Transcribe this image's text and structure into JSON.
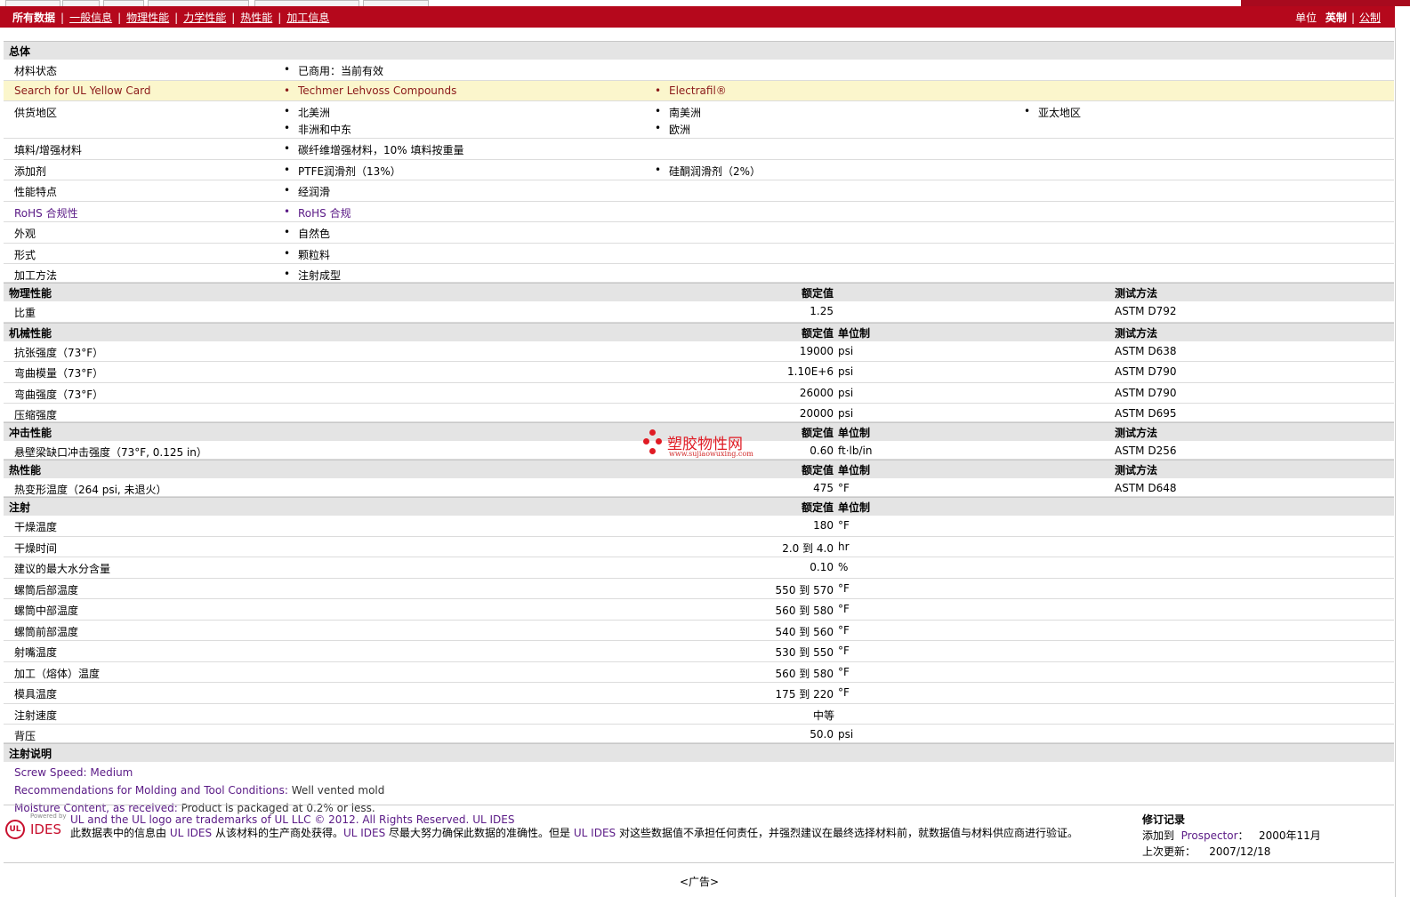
{
  "nav": {
    "items": [
      "所有数据",
      "一般信息",
      "物理性能",
      "力学性能",
      "热性能",
      "加工信息"
    ],
    "units_label": "单位",
    "unit_active": "英制",
    "unit_other": "公制"
  },
  "general": {
    "title": "总体",
    "material_status": {
      "label": "材料状态",
      "values": [
        "已商用：当前有效"
      ]
    },
    "yellow_card": {
      "label": "Search for UL Yellow Card",
      "values": [
        "Techmer Lehvoss Compounds",
        "Electrafil®"
      ]
    },
    "supply_region": {
      "label": "供货地区",
      "values": [
        "北美洲",
        "南美洲",
        "亚太地区",
        "非洲和中东",
        "欧洲"
      ]
    },
    "filler": {
      "label": "填料/增强材料",
      "values": [
        "碳纤维增强材料，10% 填料按重量"
      ]
    },
    "additive": {
      "label": "添加剂",
      "values": [
        "PTFE润滑剂（13%）",
        "硅酮润滑剂（2%）"
      ]
    },
    "features": {
      "label": "性能特点",
      "values": [
        "经润滑"
      ]
    },
    "rohs": {
      "label": "RoHS 合规性",
      "values": [
        "RoHS 合规"
      ]
    },
    "appearance": {
      "label": "外观",
      "values": [
        "自然色"
      ]
    },
    "form": {
      "label": "形式",
      "values": [
        "颗粒料"
      ]
    },
    "processing": {
      "label": "加工方法",
      "values": [
        "注射成型"
      ]
    }
  },
  "physical": {
    "title": "物理性能",
    "col_value": "额定值",
    "col_method": "测试方法",
    "rows": [
      {
        "label": "比重",
        "value": "1.25",
        "method": "ASTM D792"
      }
    ]
  },
  "mechanical": {
    "title": "机械性能",
    "col_value": "额定值",
    "col_unit": "单位制",
    "col_method": "测试方法",
    "rows": [
      {
        "label": "抗张强度（73°F）",
        "value": "19000",
        "unit": "psi",
        "method": "ASTM D638"
      },
      {
        "label": "弯曲模量（73°F）",
        "value": "1.10E+6",
        "unit": "psi",
        "method": "ASTM D790"
      },
      {
        "label": "弯曲强度（73°F）",
        "value": "26000",
        "unit": "psi",
        "method": "ASTM D790"
      },
      {
        "label": "压缩强度",
        "value": "20000",
        "unit": "psi",
        "method": "ASTM D695"
      }
    ]
  },
  "impact": {
    "title": "冲击性能",
    "col_value": "额定值",
    "col_unit": "单位制",
    "col_method": "测试方法",
    "rows": [
      {
        "label": "悬壁梁缺口冲击强度（73°F, 0.125 in）",
        "value": "0.60",
        "unit": "ft·lb/in",
        "method": "ASTM D256"
      }
    ]
  },
  "thermal": {
    "title": "热性能",
    "col_value": "额定值",
    "col_unit": "单位制",
    "col_method": "测试方法",
    "rows": [
      {
        "label": "热变形温度（264 psi, 未退火）",
        "value": "475",
        "unit": "°F",
        "method": "ASTM D648"
      }
    ]
  },
  "injection": {
    "title": "注射",
    "col_value": "额定值",
    "col_unit": "单位制",
    "rows": [
      {
        "label": "干燥温度",
        "value": "180",
        "unit": "°F"
      },
      {
        "label": "干燥时间",
        "value": "2.0 到  4.0",
        "unit": "hr"
      },
      {
        "label": "建议的最大水分含量",
        "value": "0.10",
        "unit": "%"
      },
      {
        "label": "螺筒后部温度",
        "value": "550 到  570",
        "unit": "°F"
      },
      {
        "label": "螺筒中部温度",
        "value": "560 到  580",
        "unit": "°F"
      },
      {
        "label": "螺筒前部温度",
        "value": "540 到  560",
        "unit": "°F"
      },
      {
        "label": "射嘴温度",
        "value": "530 到  550",
        "unit": "°F"
      },
      {
        "label": "加工（熔体）温度",
        "value": "560 到  580",
        "unit": "°F"
      },
      {
        "label": "模具温度",
        "value": "175 到  220",
        "unit": "°F"
      },
      {
        "label": "注射速度",
        "value": "中等",
        "unit": ""
      },
      {
        "label": "背压",
        "value": "50.0",
        "unit": "psi"
      }
    ]
  },
  "injection_notes": {
    "title": "注射说明",
    "notes": [
      {
        "key": "Screw Speed:",
        "value": "Medium"
      },
      {
        "key": "Recommendations for Molding and Tool Conditions:",
        "value": "Well vented mold"
      },
      {
        "key": "Moisture Content, as received:",
        "value": "Product is packaged at 0.2% or less."
      }
    ]
  },
  "watermark": {
    "name": "塑胶物性网",
    "url": "www.sujiaowuxing.com"
  },
  "footer": {
    "logo_powered": "Powered by",
    "logo_ul": "UL",
    "logo_ides": "IDES",
    "trademark": "UL and the UL logo are trademarks of UL LLC © 2012. All Rights Reserved.",
    "trademark_link": "UL IDES",
    "disclaimer_1": "此数据表中的信息由",
    "disclaimer_link1": "UL IDES",
    "disclaimer_2": "从该材料的生产商处获得。",
    "disclaimer_link2": "UL IDES",
    "disclaimer_3": "尽最大努力确保此数据的准确性。但是",
    "disclaimer_link3": "UL IDES",
    "disclaimer_4": "对这些数据值不承担任何责任，并强烈建议在最终选择材料前，就数据值与材料供应商进行验证。",
    "revision_title": "修订记录",
    "added_label": "添加到",
    "added_link": "Prospector",
    "added_date": "2000年11月",
    "updated_label": "上次更新：",
    "updated_date": "2007/12/18"
  },
  "ad": "<广告>"
}
